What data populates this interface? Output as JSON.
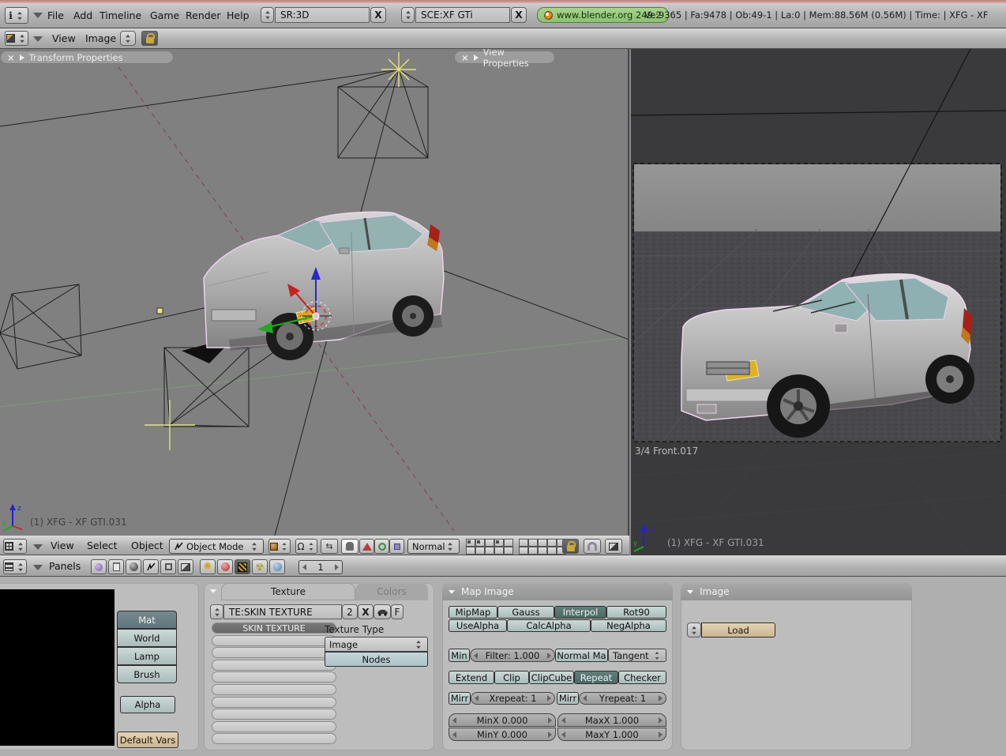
{
  "colors": {
    "header_grey": "#b6b6b6",
    "viewport_grey": "#808080",
    "camera_view_dark": "#3a3a3c",
    "button_teal": "#b9c9c7",
    "button_pressed": "#567672",
    "button_tan": "#d8c5a6",
    "badge_green": "#97c97e",
    "selection_pink": "#f0d2f0",
    "accent_top_edge": "#d89a9a"
  },
  "glyphs": {
    "close": "×",
    "delete_x": "X",
    "fake_user": "F",
    "info": "i"
  },
  "topbar": {
    "menus": [
      "File",
      "Add",
      "Timeline",
      "Game",
      "Render",
      "Help"
    ],
    "screen": "SR:3D",
    "scene": "SCE:XF GTi",
    "version": "www.blender.org 249.2",
    "stats": "Ve:9365 | Fa:9478 | Ob:49-1 | La:0 | Mem:88.56M (0.56M) | Time: | XFG - XF"
  },
  "imagebar": {
    "menus": [
      "View",
      "Image"
    ]
  },
  "viewport_left": {
    "transform_panel": "Transform Properties",
    "view_panel": "View Properties",
    "object_label": "(1) XFG - XF GTI.031"
  },
  "viewport_right": {
    "camera_label": "3/4 Front.017",
    "object_label": "(1) XFG - XF GTI.031"
  },
  "view3d_header": {
    "menus": [
      "View",
      "Select",
      "Object"
    ],
    "mode": "Object Mode",
    "orientation": "Normal"
  },
  "buttons_header": {
    "panels_label": "Panels",
    "frame": "1"
  },
  "preview_panel": {
    "context_buttons": [
      "Mat",
      "World",
      "Lamp",
      "Brush"
    ],
    "alpha": "Alpha",
    "default_vars": "Default Vars"
  },
  "texture_panel": {
    "tabs": [
      "Texture",
      "Colors"
    ],
    "datablock": "TE:SKIN TEXTURE",
    "users": "2",
    "channel_selected": "SKIN TEXTURE",
    "texture_type_label": "Texture Type",
    "texture_type": "Image",
    "nodes": "Nodes"
  },
  "map_image_panel": {
    "title": "Map Image",
    "filter_buttons": [
      "MipMap",
      "Gauss",
      "Interpol",
      "Rot90"
    ],
    "alpha_buttons": [
      "UseAlpha",
      "CalcAlpha",
      "NegAlpha"
    ],
    "min": "Min",
    "filter_value": "Filter: 1.000",
    "normal_map": "Normal Ma",
    "tangent": "Tangent",
    "extend_buttons": [
      "Extend",
      "Clip",
      "ClipCube",
      "Repeat",
      "Checker"
    ],
    "mirr_x": "Mirr",
    "xrepeat": "Xrepeat: 1",
    "mirr_y": "Mirr",
    "yrepeat": "Yrepeat: 1",
    "minx": "MinX 0.000",
    "maxx": "MaxX 1.000",
    "miny": "MinY 0.000",
    "maxy": "MaxY 1.000"
  },
  "image_panel": {
    "title": "Image",
    "load": "Load"
  }
}
